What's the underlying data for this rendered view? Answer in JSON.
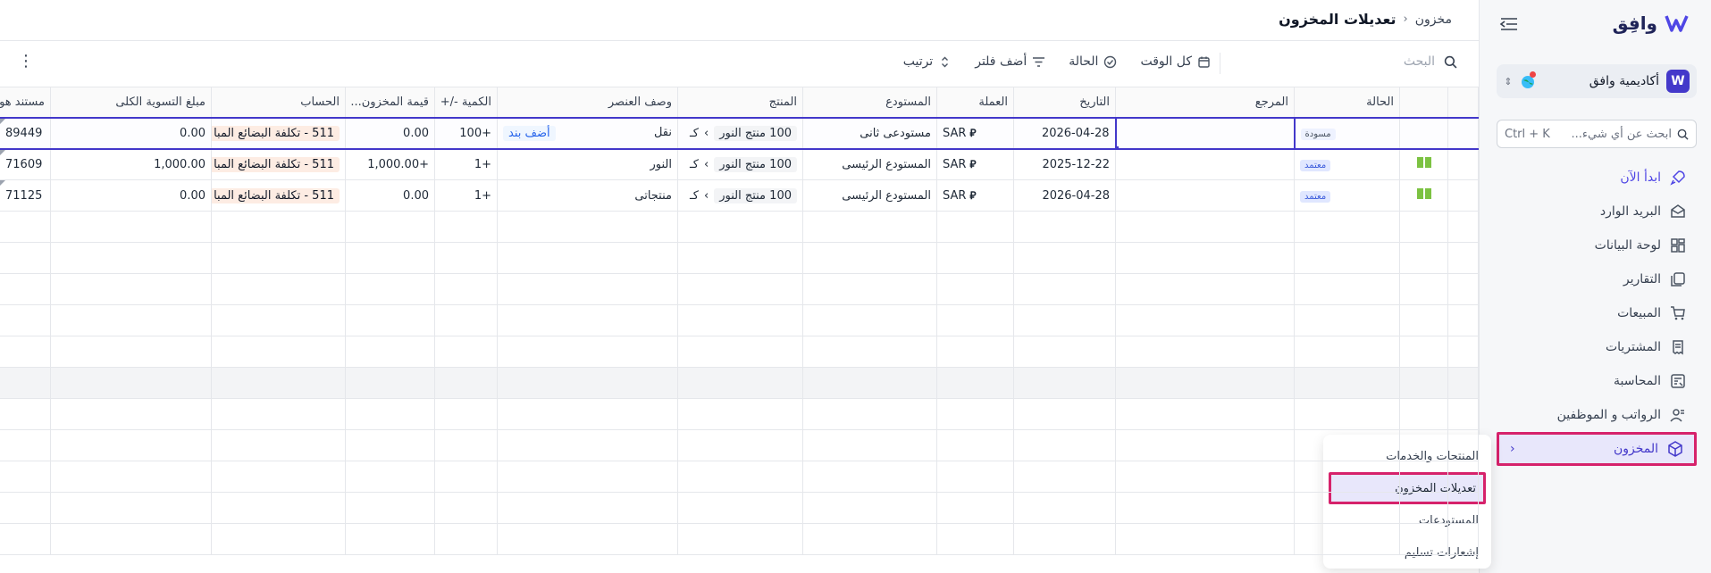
{
  "sidebar": {
    "brand": "وافِق",
    "workspace": "أكاديمية وافق",
    "search_placeholder": "ابحث عن أي شيء...",
    "search_shortcut": "Ctrl + K",
    "items": [
      {
        "label": "ابدأ الآن",
        "icon": "rocket-icon"
      },
      {
        "label": "البريد الوارد",
        "icon": "inbox-icon"
      },
      {
        "label": "لوحة البيانات",
        "icon": "dashboard-icon"
      },
      {
        "label": "التقارير",
        "icon": "reports-icon"
      },
      {
        "label": "المبيعات",
        "icon": "cart-icon"
      },
      {
        "label": "المشتريات",
        "icon": "receipt-icon"
      },
      {
        "label": "المحاسبة",
        "icon": "ledger-icon"
      },
      {
        "label": "الرواتب و الموظفين",
        "icon": "people-icon"
      },
      {
        "label": "المخزون",
        "icon": "box-icon"
      }
    ],
    "submenu": [
      {
        "label": "المنتجات والخدمات"
      },
      {
        "label": "تعديلات المخزون"
      },
      {
        "label": "المستودعات"
      },
      {
        "label": "إشعارات تسليم"
      }
    ]
  },
  "header": {
    "parent": "مخزون",
    "current": "تعديلات المخزون"
  },
  "toolbar": {
    "search_placeholder": "البحث",
    "all_time": "كل الوقت",
    "status": "الحالة",
    "add_filter": "أضف فلتر",
    "sort": "ترتيب"
  },
  "table": {
    "columns": [
      "الحالة",
      "المرجع",
      "التاريخ",
      "العملة",
      "المستودع",
      "المنتج",
      "وصف العنصر",
      "الكمية -/+",
      "قيمة المخزون...",
      "الحساب",
      "مبلغ التسوية الكلى",
      "مستند هو"
    ],
    "rows": [
      {
        "status": "مسودة",
        "reference": "",
        "date": "2026-04-28",
        "currency": "SAR",
        "warehouse": "مستودعى ثانى",
        "product": "100 منتج النور",
        "product_prefix": "كـ",
        "description": "نقل",
        "add_item": "أضف بند",
        "qty": "100+",
        "stock_value": "0.00",
        "account": "511 - تكلفة البضائع المبا",
        "total": "0.00",
        "doc": "89449"
      },
      {
        "status": "معتمد",
        "reference": "",
        "date": "2025-12-22",
        "currency": "SAR",
        "warehouse": "المستودع الرئيسى",
        "product": "100 منتج النور",
        "product_prefix": "كـ",
        "description": "النور",
        "add_item": "",
        "qty": "1+",
        "stock_value": "1,000.00+",
        "account": "511 - تكلفة البضائع المبا",
        "total": "1,000.00",
        "doc": "71609"
      },
      {
        "status": "معتمد",
        "reference": "",
        "date": "2026-04-28",
        "currency": "SAR",
        "warehouse": "المستودع الرئيسى",
        "product": "100 منتج النور",
        "product_prefix": "كـ",
        "description": "منتجاتى",
        "add_item": "",
        "qty": "1+",
        "stock_value": "0.00",
        "account": "511 - تكلفة البضائع المبا",
        "total": "0.00",
        "doc": "71125"
      }
    ]
  },
  "colors": {
    "accent": "#4338ca",
    "highlight": "#d6226b",
    "approved_book": "#7cc242"
  }
}
